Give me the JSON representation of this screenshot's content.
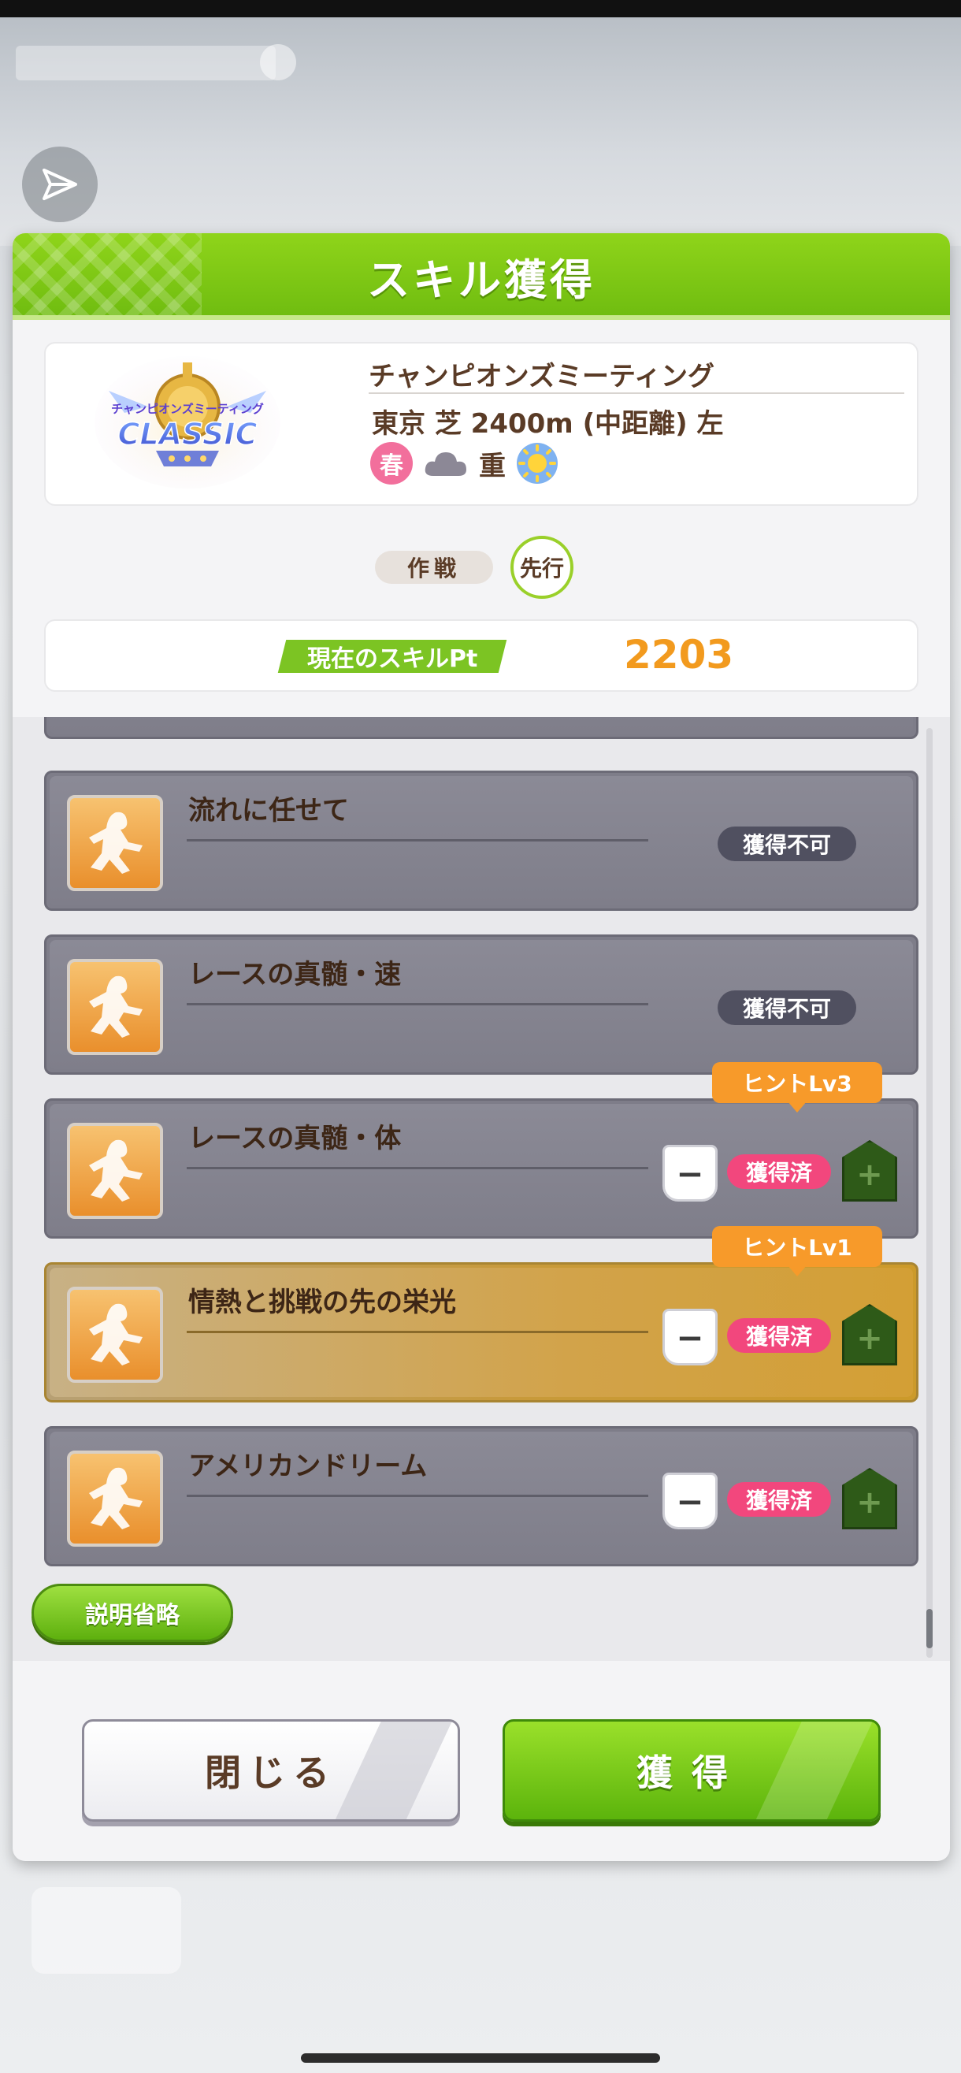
{
  "dialog": {
    "title": "スキル獲得"
  },
  "race": {
    "name": "チャンピオンズミーティング",
    "logo_text_top": "チャンピオンズミーティング",
    "logo_text_main": "CLASSIC",
    "info": "東京 芝 2400m (中距離) 左",
    "season": "春",
    "ground": "重",
    "weather_icon": "sun-icon",
    "cloud_icon": "cloud-icon"
  },
  "strategy": {
    "label": "作戦",
    "value": "先行"
  },
  "skill_pt": {
    "label": "現在のスキルPt",
    "value": "2203"
  },
  "skills": [
    {
      "name": "流れに任せて",
      "status": "獲得不可"
    },
    {
      "name": "レースの真髄・速",
      "status": "獲得不可"
    },
    {
      "name": "レースの真髄・体",
      "status": "獲得済",
      "hint": "ヒントLv3"
    },
    {
      "name": "情熱と挑戦の先の栄光",
      "status": "獲得済",
      "hint": "ヒントLv1",
      "highlight": "gold"
    },
    {
      "name": "アメリカンドリーム",
      "status": "獲得済"
    }
  ],
  "buttons": {
    "omit": "説明省略",
    "close": "閉じる",
    "acquire": "獲得",
    "minus": "−",
    "plus": "+"
  },
  "colors": {
    "header_green": "#7fc81a",
    "acquired_pink": "#f2477d",
    "hint_orange": "#f79a2a",
    "pt_orange": "#f29a1e"
  }
}
